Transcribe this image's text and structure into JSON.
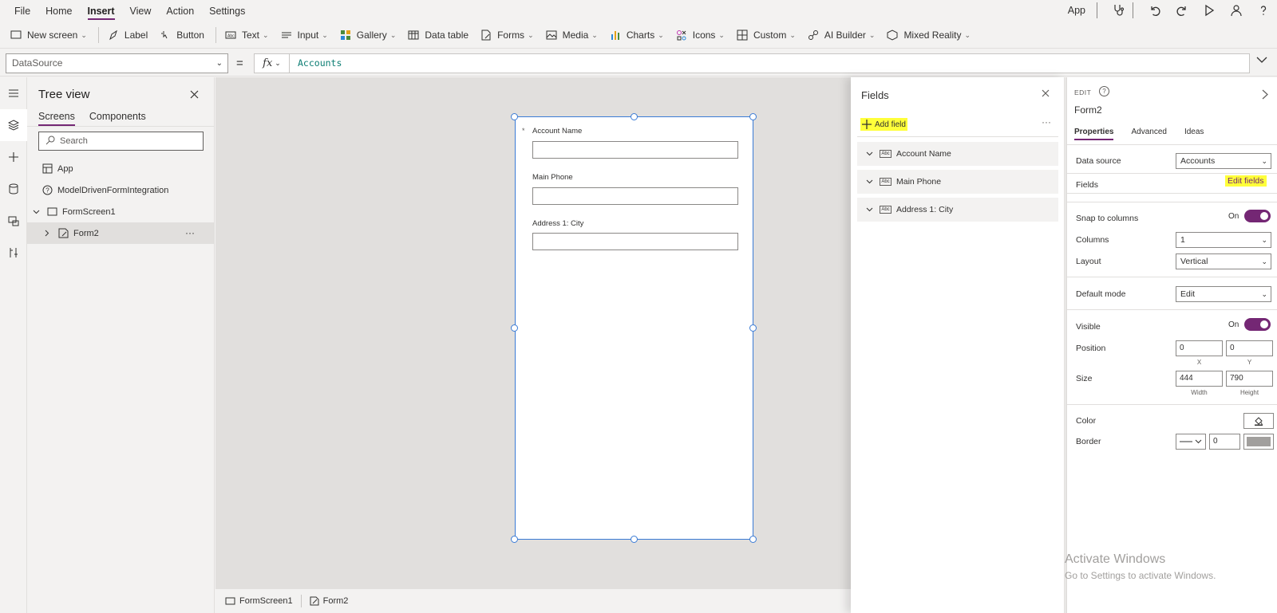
{
  "menubar": {
    "items": [
      "File",
      "Home",
      "Insert",
      "View",
      "Action",
      "Settings"
    ],
    "active": "Insert",
    "app_label": "App"
  },
  "toolbar": {
    "new_screen": "New screen",
    "label": "Label",
    "button": "Button",
    "text": "Text",
    "input": "Input",
    "gallery": "Gallery",
    "data_table": "Data table",
    "forms": "Forms",
    "media": "Media",
    "charts": "Charts",
    "icons": "Icons",
    "custom": "Custom",
    "ai_builder": "AI Builder",
    "mixed_reality": "Mixed Reality"
  },
  "formula": {
    "property": "DataSource",
    "equals": "=",
    "fx": "fx",
    "value": "Accounts"
  },
  "tree": {
    "title": "Tree view",
    "tabs": [
      "Screens",
      "Components"
    ],
    "search_placeholder": "Search",
    "nodes": {
      "app": "App",
      "integration": "ModelDrivenFormIntegration",
      "screen": "FormScreen1",
      "form": "Form2"
    }
  },
  "form": {
    "fields": [
      {
        "label": "Account Name",
        "required": "*"
      },
      {
        "label": "Main Phone"
      },
      {
        "label": "Address 1: City"
      }
    ]
  },
  "bottombar": {
    "screen": "FormScreen1",
    "control": "Form2"
  },
  "fields_panel": {
    "title": "Fields",
    "add_field": "Add field",
    "more": "···",
    "items": [
      "Account Name",
      "Main Phone",
      "Address 1: City"
    ],
    "type_badge": "Abc"
  },
  "properties": {
    "edit_label": "EDIT",
    "control_name": "Form2",
    "tabs": [
      "Properties",
      "Advanced",
      "Ideas"
    ],
    "data_source_label": "Data source",
    "data_source_value": "Accounts",
    "fields_label": "Fields",
    "edit_fields": "Edit fields",
    "snap_label": "Snap to columns",
    "snap_state": "On",
    "columns_label": "Columns",
    "columns_value": "1",
    "layout_label": "Layout",
    "layout_value": "Vertical",
    "default_mode_label": "Default mode",
    "default_mode_value": "Edit",
    "visible_label": "Visible",
    "visible_state": "On",
    "position_label": "Position",
    "position_x": "0",
    "position_y": "0",
    "x_caption": "X",
    "y_caption": "Y",
    "size_label": "Size",
    "width": "444",
    "height": "790",
    "width_caption": "Width",
    "height_caption": "Height",
    "color_label": "Color",
    "border_label": "Border",
    "border_width": "0"
  },
  "watermark": {
    "line1": "Activate Windows",
    "line2": "Go to Settings to activate Windows."
  },
  "colors": {
    "accent": "#742774",
    "highlight": "#ffff3a",
    "selection": "#3a7bd5"
  }
}
